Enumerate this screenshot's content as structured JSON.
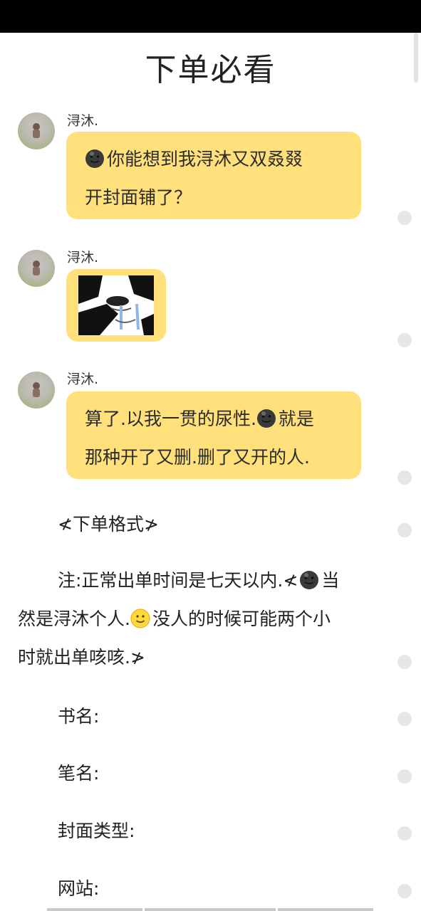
{
  "page": {
    "title": "下单必看"
  },
  "messages": [
    {
      "sender": "浔沐.",
      "line1": "你能想到我浔沐又双叒叕",
      "line2": "开封面铺了？"
    },
    {
      "sender": "浔沐.",
      "type": "sticker",
      "sticker_icon": "crying-panda-meme-sticker"
    },
    {
      "sender": "浔沐.",
      "line1": "算了.以我一贯的尿性.",
      "line1b": "就是",
      "line2": "那种开了又删.删了又开的人."
    }
  ],
  "order": {
    "format_heading": "≮下单格式≯",
    "note_line1a": "注:正常出单时间是七天以内.≮",
    "note_line1b": "当",
    "note_line2a": "然是浔沐个人.",
    "note_line2b": "没人的时候可能两个小",
    "note_line3": "时就出单咳咳.≯",
    "fields": [
      "书名:",
      "笔名:",
      "封面类型:",
      "网站:"
    ]
  },
  "colors": {
    "bubble": "#ffe07a",
    "status_bar": "#000000",
    "dot": "#e6e6e6"
  }
}
